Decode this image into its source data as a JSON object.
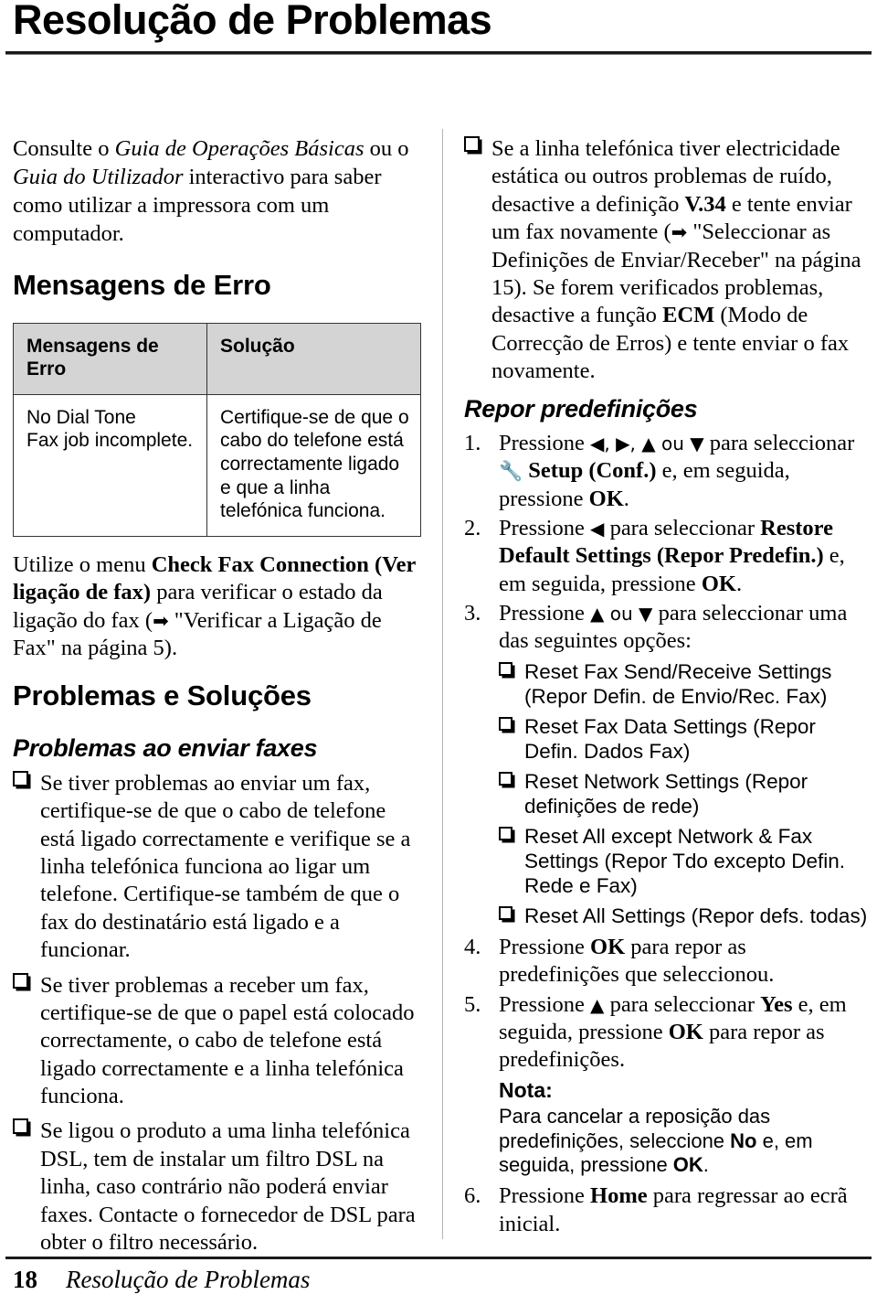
{
  "page": {
    "title": "Resolução de Problemas",
    "footer_page_number": "18",
    "footer_title": "Resolução de Problemas"
  },
  "left_column": {
    "intro": {
      "prefix": "Consulte o ",
      "italic1": "Guia de Operações Básicas",
      "mid": " ou o ",
      "italic2": "Guia do Utilizador",
      "suffix": " interactivo para saber como utilizar a impressora com um computador."
    },
    "error_messages_heading": "Mensagens de Erro",
    "table": {
      "headers": [
        "Mensagens de Erro",
        "Solução"
      ],
      "rows": [
        {
          "message": "No Dial Tone\nFax job incomplete.",
          "solution": "Certifique-se de que o cabo do telefone está correctamente ligado e que a linha telefónica funciona."
        }
      ]
    },
    "check_fax_para": {
      "p1": "Utilize o menu ",
      "b1": "Check Fax Connection (Ver ligação de fax)",
      "p2": " para verificar o estado da ligação do fax (",
      "arrow": "➡",
      "p3": " \"Verificar a Ligação de Fax\" na página 5)."
    },
    "problems_heading": "Problemas e Soluções",
    "sending_faxes_subheading": "Problemas ao enviar faxes",
    "bullets": [
      "Se tiver problemas ao enviar um fax, certifique-se de que o cabo de telefone está ligado correctamente e verifique se a linha telefónica funciona ao ligar um telefone. Certifique-se também de que o fax do destinatário está ligado e a funcionar.",
      "Se tiver problemas a receber um fax, certifique-se de que o papel está colocado correctamente, o cabo de telefone está ligado correctamente e a linha telefónica funciona.",
      "Se ligou o produto a uma linha telefónica DSL, tem de instalar um filtro DSL na linha, caso contrário não poderá enviar faxes. Contacte o fornecedor de DSL para obter o filtro necessário."
    ]
  },
  "right_column": {
    "static_bullet": {
      "t1": "Se a linha telefónica tiver electricidade estática ou outros problemas de ruído, desactive a definição ",
      "b1": "V.34",
      "t2": " e tente enviar um fax novamente (",
      "arrow": "➡",
      "t3": " \"Seleccionar as Definições de Enviar/Receber\" na página 15). Se forem verificados problemas, desactive a função ",
      "b2": "ECM",
      "t4": " (Modo de Correcção de Erros) e tente enviar o fax novamente."
    },
    "reset_heading": "Repor predefinições",
    "steps": [
      {
        "t1": "Pressione ",
        "keys1": "◀, ▶, ▲ ou ▼",
        "t2": " para seleccionar ",
        "icon": "🔧",
        "b1": " Setup (Conf.)",
        "t3": " e, em seguida, pressione ",
        "b2": "OK",
        "t4": "."
      },
      {
        "t1": "Pressione ",
        "keys1": "◀",
        "t2": " para seleccionar ",
        "b1": "Restore Default Settings (Repor Predefin.)",
        "t3": " e, em seguida, pressione ",
        "b2": "OK",
        "t4": "."
      },
      {
        "t1": "Pressione ",
        "keys1": "▲ ou ▼",
        "t2": " para seleccionar uma das seguintes opções:",
        "options": [
          "Reset Fax Send/Receive Settings (Repor Defin. de Envio/Rec. Fax)",
          "Reset Fax Data Settings (Repor Defin. Dados Fax)",
          "Reset Network Settings (Repor definições de rede)",
          "Reset All except Network & Fax Settings (Repor Tdo excepto Defin. Rede e Fax)",
          "Reset All Settings (Repor defs. todas)"
        ]
      },
      {
        "t1": "Pressione ",
        "b1": "OK",
        "t2": " para repor as predefinições que seleccionou."
      },
      {
        "t1": "Pressione ",
        "keys1": "▲",
        "t2": " para seleccionar ",
        "b1": "Yes",
        "t3": " e, em seguida, pressione ",
        "b2": "OK",
        "t4": " para repor as predefinições.",
        "note_heading": "Nota:",
        "note_t1": "Para cancelar a reposição das predefinições, seleccione ",
        "note_b1": "No",
        "note_t2": " e, em seguida, pressione ",
        "note_b2": "OK",
        "note_t3": "."
      },
      {
        "t1": "Pressione ",
        "b1": "Home",
        "t2": " para regressar ao ecrã inicial."
      }
    ]
  }
}
